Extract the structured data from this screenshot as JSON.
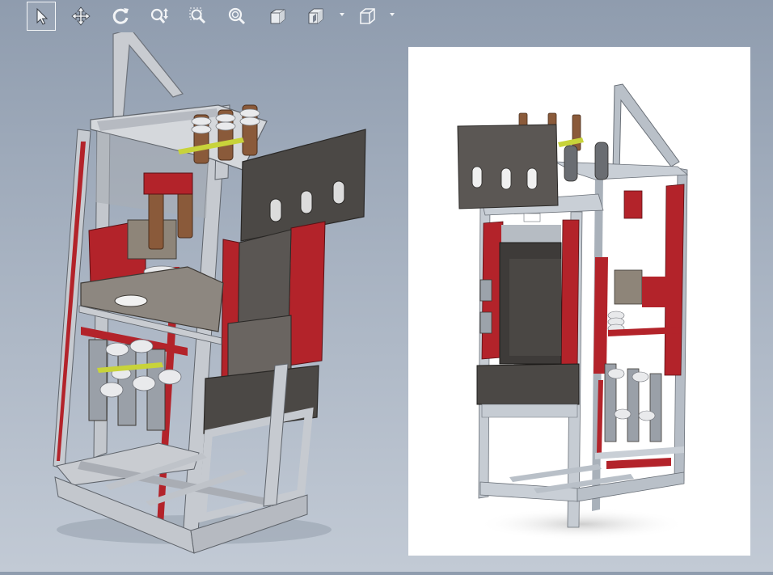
{
  "toolbar": {
    "buttons": [
      {
        "icon": "select-arrow-icon",
        "active": true
      },
      {
        "icon": "pan-move-icon",
        "active": false
      },
      {
        "icon": "rotate-view-icon",
        "active": false
      },
      {
        "icon": "zoom-in-out-icon",
        "active": false
      },
      {
        "icon": "zoom-to-area-icon",
        "active": false
      },
      {
        "icon": "zoom-to-fit-icon",
        "active": false
      },
      {
        "icon": "standard-views-cube-icon",
        "active": false
      },
      {
        "icon": "section-view-icon",
        "has_dropdown": true
      },
      {
        "icon": "display-style-cube-icon",
        "has_dropdown": true
      }
    ]
  },
  "colors": {
    "background_top": "#8f9cae",
    "background_bottom": "#c2cad5",
    "frame_steel": "#b9bec6",
    "frame_red": "#b3232a",
    "panel_dark": "#4a4744",
    "insulator_brown": "#8a5a3a",
    "render_panel": "#ffffff"
  },
  "viewport": {
    "model": "switchgear-cabinet-cad-model",
    "render": "switchgear-cabinet-photorealistic-render"
  }
}
